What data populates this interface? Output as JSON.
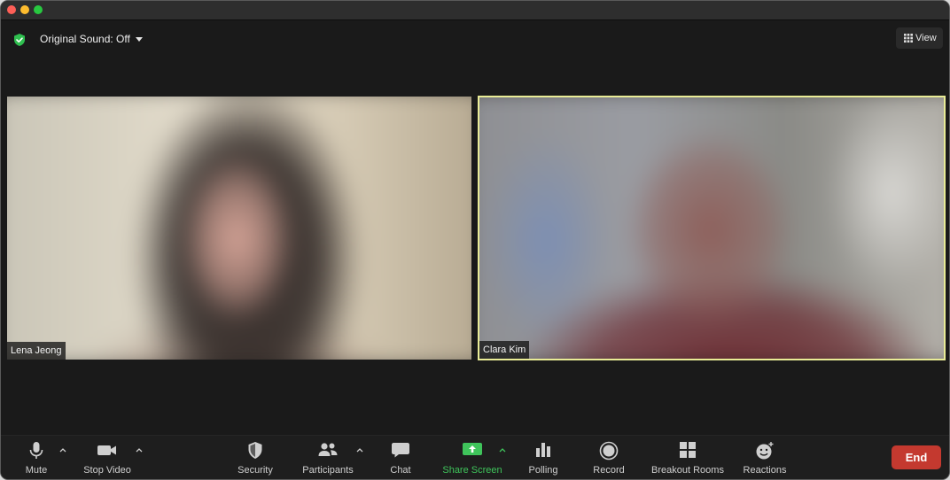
{
  "topbar": {
    "sound_label": "Original Sound: Off",
    "view_label": "View"
  },
  "participants": [
    {
      "name": "Lena Jeong"
    },
    {
      "name": "Clara Kim"
    }
  ],
  "toolbar": {
    "mute": "Mute",
    "stop_video": "Stop Video",
    "security": "Security",
    "participants": "Participants",
    "chat": "Chat",
    "share_screen": "Share Screen",
    "polling": "Polling",
    "record": "Record",
    "breakout_rooms": "Breakout Rooms",
    "reactions": "Reactions",
    "end": "End"
  },
  "colors": {
    "share_green": "#3fc45b",
    "end_red": "#c4392f",
    "active_speaker_border": "#e9ec96"
  }
}
